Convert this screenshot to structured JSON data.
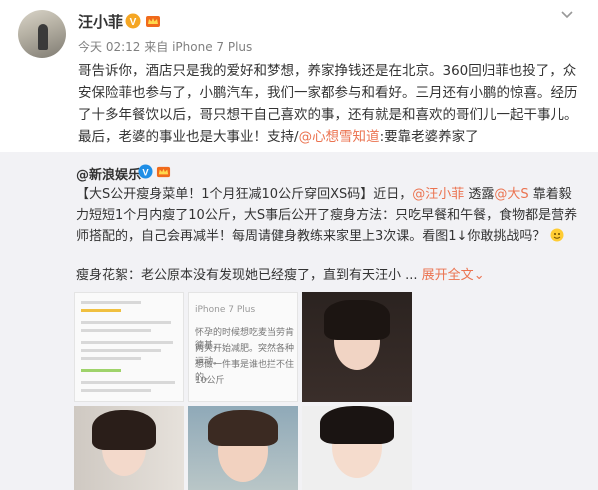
{
  "user": {
    "name": "汪小菲",
    "time": "今天 02:12",
    "source_prefix": "来自",
    "source": "iPhone 7 Plus"
  },
  "post": {
    "text_1": "哥告诉你，酒店只是我的爱好和梦想，养家挣钱还是在北京。360回归菲也投了，众安保险菲也参与了，小鹏汽车，我们一家都参与和看好。三月还有小鹏的惊喜。经历了十多年餐饮以后，哥只想干自己喜欢的事，还有就是和喜欢的哥们儿一起干事儿。最后，老婆的事业也是大事业！支持/",
    "mention": "@心想雪知道",
    "text_2": ":要靠老婆养家了"
  },
  "retweet": {
    "name": "@新浪娱乐",
    "text_a": "【大S公开瘦身菜单！1个月狂减10公斤穿回XS码】近日，",
    "mention_1": "@汪小菲",
    "text_b": " 透露",
    "mention_2": "@大S",
    "text_c": " 靠着毅力短短1个月内瘦了10公斤，大S事后公开了瘦身方法：只吃早餐和午餐，食物都是营养师搭配的，自己会再减半！每周请健身教练来家里上3次课。看图1↓你敢挑战吗？",
    "excerpt": "瘦身花絮：老公原本没有发现她已经瘦了，直到有天汪小 ...",
    "expand": "展开全文",
    "expand_arrow": "⌄"
  },
  "thumbs": {
    "t2_line1": "iPhone 7 Plus",
    "t2_line2": "怀孕的时候想吃麦当劳肯德基，",
    "t2_line3": "两天开始减肥。突然各种运动。",
    "t2_line4": "想做一件事是谁也拦不住的。",
    "t2_line5": "10公斤"
  }
}
